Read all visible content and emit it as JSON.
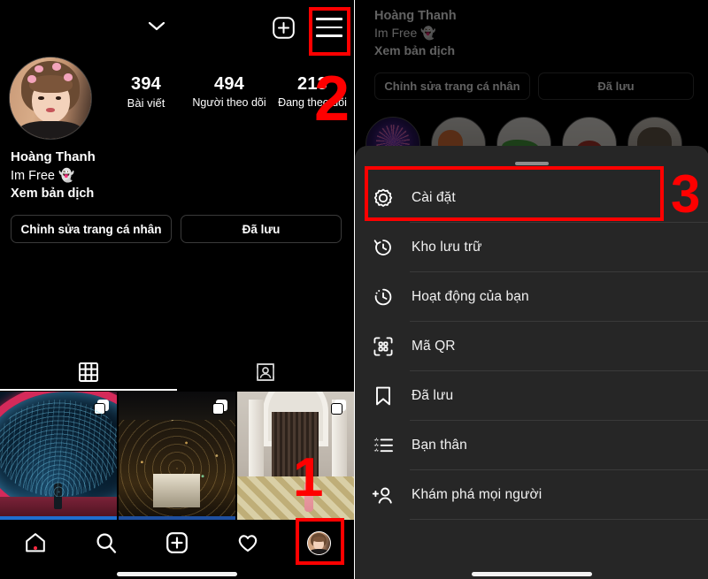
{
  "left_panel": {
    "topbar": {
      "account_switch_icon": "chevron-down-icon",
      "new_post_icon": "plus-square-icon",
      "menu_icon": "hamburger-menu-icon"
    },
    "profile": {
      "avatar_alt": "profile-avatar",
      "name": "Hoàng Thanh",
      "bio": "Im Free 👻",
      "translate_link": "Xem bản dịch",
      "stats": [
        {
          "number": "394",
          "label": "Bài viết"
        },
        {
          "number": "494",
          "label": "Người theo dõi"
        },
        {
          "number": "213",
          "label": "Đang theo dõi"
        }
      ],
      "buttons": [
        {
          "label": "Chỉnh sửa trang cá nhân"
        },
        {
          "label": "Đã lưu"
        }
      ]
    },
    "tabs": [
      {
        "name": "grid-tab",
        "icon": "grid-icon",
        "active": true
      },
      {
        "name": "tagged-tab",
        "icon": "tagged-person-icon",
        "active": false
      }
    ],
    "posts": [
      {
        "alt": "tunnel-of-lights-photo",
        "multi": true
      },
      {
        "alt": "night-city-aerial-photo",
        "multi": true
      },
      {
        "alt": "white-building-entrance-photo",
        "multi": true
      }
    ],
    "bottom_nav": [
      {
        "name": "home-tab",
        "icon": "home-icon",
        "badge": true
      },
      {
        "name": "search-tab",
        "icon": "search-icon",
        "badge": false
      },
      {
        "name": "create-tab",
        "icon": "plus-square-icon",
        "badge": false
      },
      {
        "name": "activity-tab",
        "icon": "heart-icon",
        "badge": false
      },
      {
        "name": "profile-tab",
        "icon": "avatar-icon",
        "badge": false
      }
    ]
  },
  "right_panel": {
    "profile": {
      "name": "Hoàng Thanh",
      "bio": "Im Free 👻",
      "translate_link": "Xem bản dịch",
      "buttons": [
        {
          "label": "Chỉnh sửa trang cá nhân"
        },
        {
          "label": "Đã lưu"
        }
      ]
    },
    "highlights": [
      {
        "alt": "ferris-wheel-highlight"
      },
      {
        "alt": "food-bowl-highlight"
      },
      {
        "alt": "green-plant-highlight"
      },
      {
        "alt": "red-dish-highlight"
      },
      {
        "alt": "brown-food-highlight"
      }
    ],
    "sheet": {
      "handle": "drag-handle",
      "menu_items": [
        {
          "label": "Cài đặt",
          "icon": "gear-icon"
        },
        {
          "label": "Kho lưu trữ",
          "icon": "archive-clock-icon"
        },
        {
          "label": "Hoạt động của bạn",
          "icon": "activity-clock-icon"
        },
        {
          "label": "Mã QR",
          "icon": "qr-code-icon"
        },
        {
          "label": "Đã lưu",
          "icon": "bookmark-icon"
        },
        {
          "label": "Bạn thân",
          "icon": "close-friends-list-icon"
        },
        {
          "label": "Khám phá mọi người",
          "icon": "discover-people-icon"
        }
      ]
    }
  },
  "annotations": {
    "highlight_color": "#ff0000",
    "steps": [
      {
        "number": "1",
        "target": "profile-tab"
      },
      {
        "number": "2",
        "target": "hamburger-menu-icon"
      },
      {
        "number": "3",
        "target": "settings-menu-item"
      }
    ]
  }
}
